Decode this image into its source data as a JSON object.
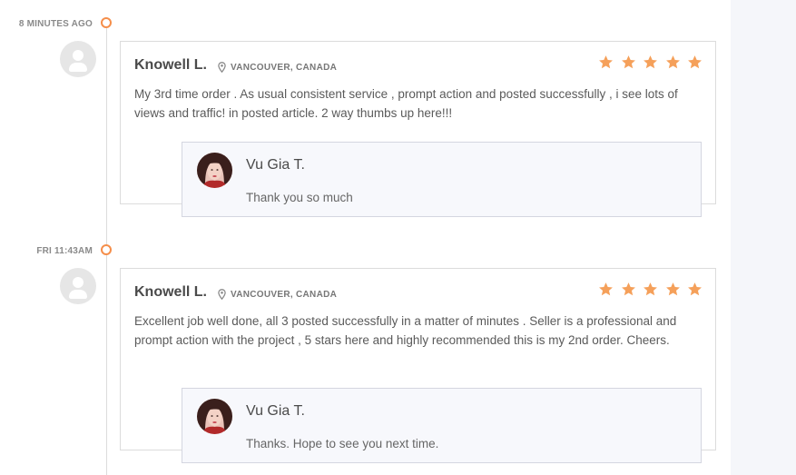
{
  "colors": {
    "accent": "#f58e4a",
    "star": "#f5a05a",
    "timeline": "#dcdcdc",
    "side_panel": "#f5f6fa"
  },
  "reviews": [
    {
      "time": "8 MINUTES AGO",
      "reviewer": "Knowell L.",
      "location": "VANCOUVER, CANADA",
      "rating": 5,
      "text": "My 3rd time order . As usual consistent service , prompt action and posted successfully , i see lots of views and traffic! in posted article. 2 way thumbs up here!!!",
      "reply": {
        "name": "Vu Gia T.",
        "text": "Thank you so much"
      }
    },
    {
      "time": "FRI 11:43AM",
      "reviewer": "Knowell L.",
      "location": "VANCOUVER, CANADA",
      "rating": 5,
      "text": "Excellent job well done, all 3 posted successfully in a matter of minutes . Seller is a professional and prompt action with the project , 5 stars here and highly recommended this is my 2nd order. Cheers.",
      "reply": {
        "name": "Vu Gia T.",
        "text": "Thanks. Hope to see you next time."
      }
    }
  ],
  "icons": {
    "location": "map-pin-icon",
    "star": "star-icon",
    "avatar": "user-placeholder-icon"
  }
}
